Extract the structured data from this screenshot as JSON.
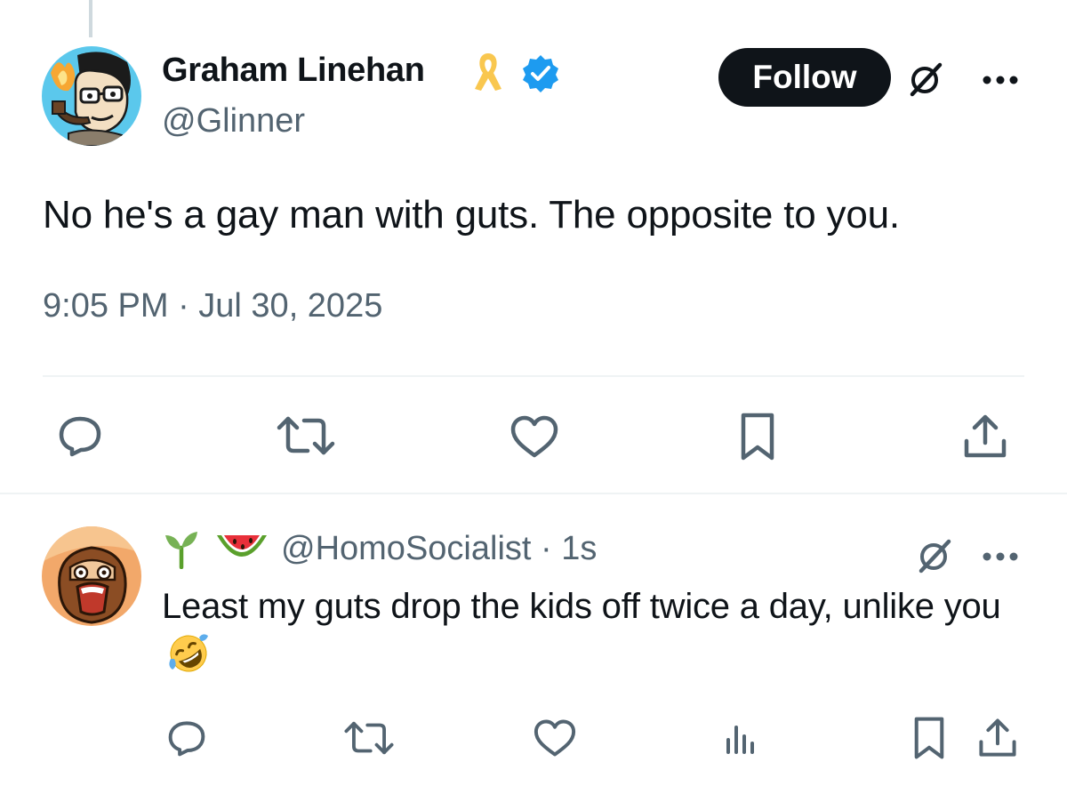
{
  "main_tweet": {
    "author_name": "Graham Linehan",
    "handle": "@Glinner",
    "follow_label": "Follow",
    "text": "No he's a gay man with guts. The opposite to you.",
    "timestamp": "9:05 PM · Jul 30, 2025",
    "badges": [
      "yellow-ribbon-icon",
      "verified-badge-icon"
    ],
    "actions": [
      "reply-icon",
      "retweet-icon",
      "like-icon",
      "bookmark-icon",
      "share-icon"
    ]
  },
  "reply": {
    "name_emojis": [
      "seedling-emoji",
      "watermelon-emoji"
    ],
    "handle_time": "@HomoSocialist · 1s",
    "text": "Least my guts drop the kids off twice a day, unlike you",
    "trailing_emoji": "rolling-on-floor-laughing-emoji",
    "actions": [
      "reply-icon",
      "retweet-icon",
      "like-icon",
      "views-icon",
      "bookmark-icon",
      "share-icon"
    ]
  },
  "colors": {
    "text": "#0f1419",
    "secondary": "#536471",
    "verified": "#1d9bf0",
    "follow_bg": "#0f1419",
    "divider": "#eff3f4",
    "ribbon": "#f9c74f"
  }
}
